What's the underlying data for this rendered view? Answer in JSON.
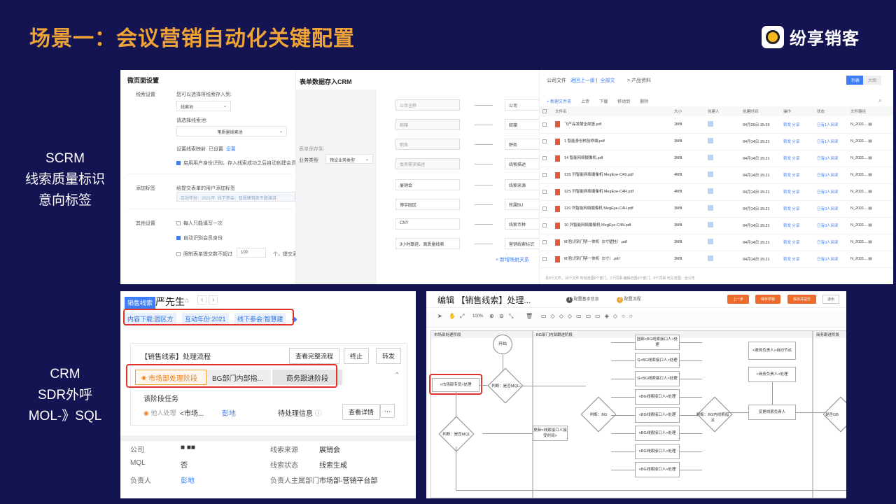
{
  "slide": {
    "title": "场景一：会议营销自动化关键配置",
    "brand": "纷享销客",
    "side_scrm": [
      "SCRM",
      "线索质量标识",
      "意向标签"
    ],
    "side_crm": [
      "CRM",
      "SDR外呼",
      "MOL-》SQL"
    ]
  },
  "micro_page": {
    "title": "微页面设置",
    "lead_settings": "线索设置",
    "choose_store": "您可以选择将线索存入到:",
    "store_value": "线索池",
    "choose_pool": "请选择线索池:",
    "pool_value": "笔质量线索池",
    "mapping_label": "设置线索映射",
    "mapping_status": "已设置",
    "mapping_action": "设置",
    "enable_identity": "启用用户身份识别。存入线索成功之后自动创建会员",
    "add_tag": "添加标签",
    "add_tag_desc": "给提交表单的用户添加标签",
    "tag1": "互动年份：2021年",
    "tag2": "线下参会：智慧建筑商专题演讲",
    "other_settings": "其他设置",
    "opt1": "每人只能填写一次",
    "opt2": "自动识别会员身份",
    "opt3": "限制表单提交数不超过",
    "opt3_value": "100",
    "opt3_suffix": "个，提交满"
  },
  "form_crm": {
    "title": "表单数据存入CRM",
    "store_to": "表单保存到",
    "biz_type_label": "业务类型",
    "biz_type_value": "预设业务类型",
    "left_fields": [
      "公司全称",
      "邮箱",
      "职务",
      "会务需求描述",
      "展销会",
      "博宇园区",
      "CNY",
      "3小时跟进、高质量线索"
    ],
    "right_fields": [
      "公司",
      "邮箱",
      "职务",
      "线索描述",
      "线索来源",
      "所属BU",
      "线索币种",
      "营销线索标识"
    ],
    "add_mapping": "+ 新增映射关系"
  },
  "files": {
    "crumb_root": "公司文件",
    "crumb_back": "返回上一级",
    "crumb_all": "全部文",
    "crumb_tail": "> 产品资料",
    "view_list": "列表",
    "view_grid": "大图",
    "toolbar": [
      "+ 新建文件夹",
      "上传",
      "下载",
      "移动到",
      "删除"
    ],
    "headers": [
      "文件名",
      "大小",
      "创建人",
      "创建时间",
      "操作",
      "状态",
      "文件路径"
    ],
    "rows": [
      {
        "name": "飞产品发酵全部篮.pdf",
        "size": "1MB",
        "time": "04月26日 15:39",
        "ops": "转发  分享",
        "status": "已有1人阅读",
        "path": "N_2021..."
      },
      {
        "name": "1 智能身份核验终端.pdf",
        "size": "3MB",
        "time": "04月14日 15:21",
        "ops": "转发  分享",
        "status": "已有1人阅读",
        "path": "N_2021..."
      },
      {
        "name": "14 智能网络摄像机.pdf",
        "size": "3MB",
        "time": "04月14日 15:21",
        "ops": "转发  分享",
        "status": "已有0人阅读",
        "path": "N_2021..."
      },
      {
        "name": "13S 列智能网络摄像机 MegEye-C4S.pdf",
        "size": "4MB",
        "time": "04月14日 15:21",
        "ops": "转发  分享",
        "status": "已有0人阅读",
        "path": "N_2021..."
      },
      {
        "name": "12S 列智能网络摄像机 MegEye-C4R.pdf",
        "size": "4MB",
        "time": "04月14日 15:21",
        "ops": "转发  分享",
        "status": "已有0人阅读",
        "path": "N_2021..."
      },
      {
        "name": "11S 列智能网络摄像机 MegEye-C4H.pdf",
        "size": "3MB",
        "time": "04月14日 15:21",
        "ops": "转发  分享",
        "status": "已有0人阅读",
        "path": "N_2021..."
      },
      {
        "name": "10 列智能网络摄像机 MegEye-C4N.pdf",
        "size": "3MB",
        "time": "04月14日 15:21",
        "ops": "转发  分享",
        "status": "已有0人阅读",
        "path": "N_2021..."
      },
      {
        "name": "M 脸识别门禁一体机（5寸壁挂）.pdf",
        "size": "3MB",
        "time": "04月14日 15:21",
        "ops": "转发  分享",
        "status": "已有0人阅读",
        "path": "N_2021..."
      },
      {
        "name": "M 脸识别门禁一体机（5寸）.pdf",
        "size": "3MB",
        "time": "04月14日 15:21",
        "ops": "转发  分享",
        "status": "已有0人阅读",
        "path": "N_2021..."
      }
    ],
    "footer": "共9个文件，16个文件   所有范围0个部门、1个同事   编辑范围0个部门、0个同事   可见范围：全公司"
  },
  "crm_lead": {
    "badge": "销售线索",
    "name": "严先生",
    "tags": [
      "内容下载:园区方",
      "互动年份:2021",
      "线下参会:智慧建"
    ],
    "process_title": "【销售线索】处理流程",
    "btn_view_full": "查看完整流程",
    "btn_stop": "终止",
    "btn_forward": "转发",
    "stages": [
      "市场部处理阶段",
      "BG部门内部指...",
      "商务跟进阶段"
    ],
    "task_title": "该阶段任务",
    "task_handler": "他人处理",
    "task_name": "<市场...",
    "task_person": "彭地",
    "task_status": "待处理信息",
    "btn_detail": "查看详情",
    "more": "···",
    "fields": [
      {
        "label": "公司",
        "value": "■ ■■"
      },
      {
        "label": "线索来源",
        "value": "展销会"
      },
      {
        "label": "MQL",
        "value": "否"
      },
      {
        "label": "线索状态",
        "value": "线索生成"
      },
      {
        "label": "负责人",
        "value": "彭地"
      },
      {
        "label": "负责人主属部门",
        "value": "市场部-营销平台部"
      }
    ]
  },
  "flow": {
    "title": "编辑 【销售线索】处理...",
    "step1": "配置基本信息",
    "step2": "配置流程",
    "btn_prev": "上一步",
    "btn_save": "保存草稿",
    "btn_publish": "保存并提交",
    "btn_exit": "退出",
    "zoom": "100%",
    "lane1": "市场部处理阶段",
    "lane2": "BG部门内部跟进阶段",
    "lane3": "商务跟进阶段",
    "start": "开始",
    "node_market": "<市场部专员>处理",
    "judge_mql": "判断：是否MQL",
    "judge_mql2": "判断：是否MQL",
    "judge_bg": "判断：BG",
    "judge_bg2": "判断：BG内线索指派",
    "update_node": "更新<线索接口人接受时间>",
    "bg_nodes": [
      "园部<BG线索接口人>处理",
      "G<BG线索接口人>处理",
      "G<BG线索接口人>处理",
      "<BG线索接口人>处理",
      "<BG线索接口人>处理",
      "<BG线索接口人>处理",
      "<BG线索接口人>处理",
      "<BG线索接口人>处理"
    ],
    "biz_nodes": [
      "<商务负责人>自动节点",
      "<商务负责人>处理",
      "变更线索负责人"
    ],
    "end_cut": "是否OB"
  },
  "colors": {
    "bg": "#141452",
    "title": "#f0a437",
    "highlight": "#e0342a",
    "link": "#3d7df5"
  }
}
